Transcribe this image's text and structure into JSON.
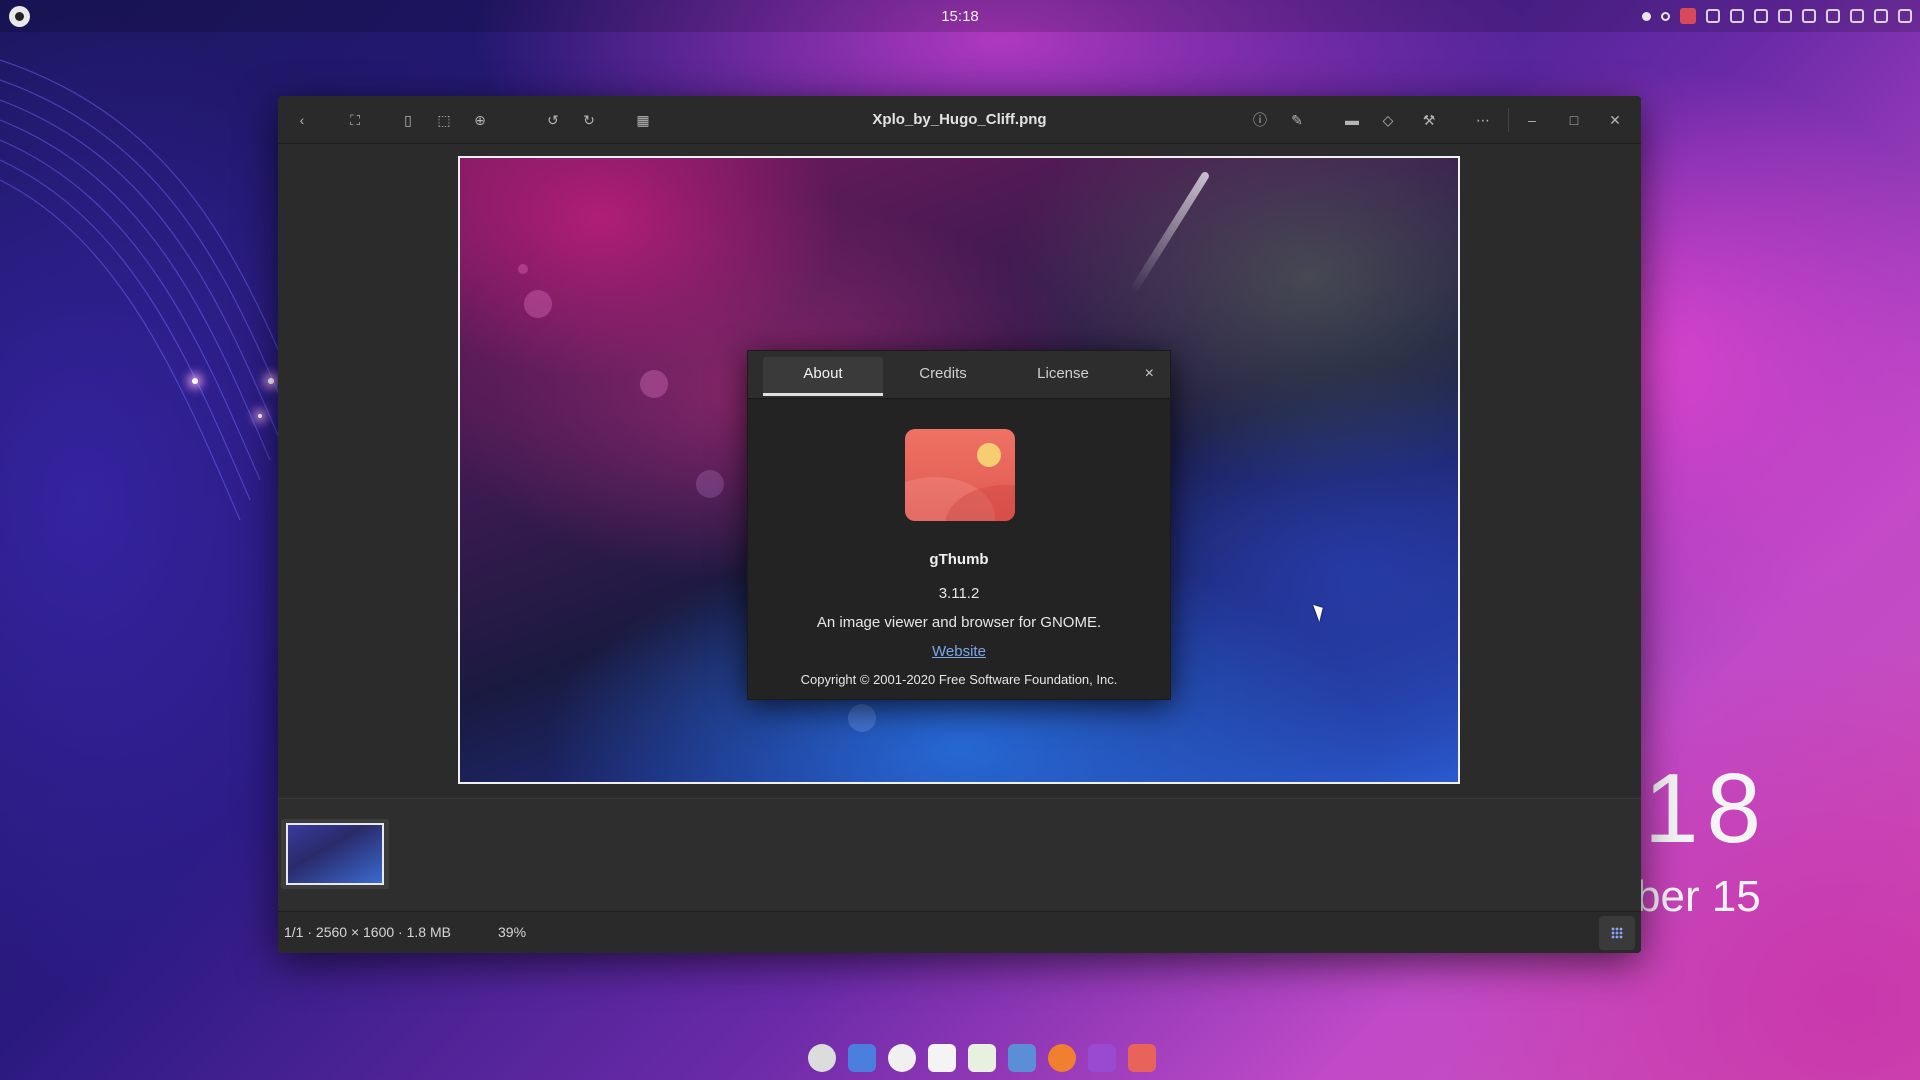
{
  "topbar": {
    "clock": "15:18"
  },
  "desktop_widget": {
    "time": "18",
    "date": "ber 15"
  },
  "window": {
    "title": "Xplo_by_Hugo_Cliff.png",
    "toolbar_left_icons": [
      "back-icon",
      "fullscreen-icon",
      "fit-page-icon",
      "fit-width-icon",
      "zoom-in-icon",
      "rotate-left-icon",
      "rotate-right-icon",
      "transparency-icon"
    ],
    "toolbar_right_icons": [
      "info-icon",
      "edit-icon",
      "comment-icon",
      "tag-icon",
      "tools-icon",
      "more-icon",
      "minimize-icon",
      "maximize-icon",
      "close-icon"
    ]
  },
  "statusbar": {
    "info": "1/1 · 2560 × 1600 · 1.8 MB",
    "zoom": "39%"
  },
  "about_dialog": {
    "tabs": [
      {
        "label": "About",
        "active": true
      },
      {
        "label": "Credits",
        "active": false
      },
      {
        "label": "License",
        "active": false
      }
    ],
    "close_label": "×",
    "app_name": "gThumb",
    "version": "3.11.2",
    "description": "An image viewer and browser for GNOME.",
    "website_label": "Website",
    "copyright": "Copyright © 2001-2020 Free Software Foundation, Inc."
  },
  "colors": {
    "accent": "#7aa7e8",
    "app_icon": "#e8635a",
    "sun": "#f7cd72"
  },
  "dock": [
    "system-icon",
    "mail-icon",
    "music-icon",
    "document-icon",
    "spreadsheet-icon",
    "folder-icon",
    "firefox-icon",
    "podcast-icon",
    "gthumb-icon"
  ]
}
